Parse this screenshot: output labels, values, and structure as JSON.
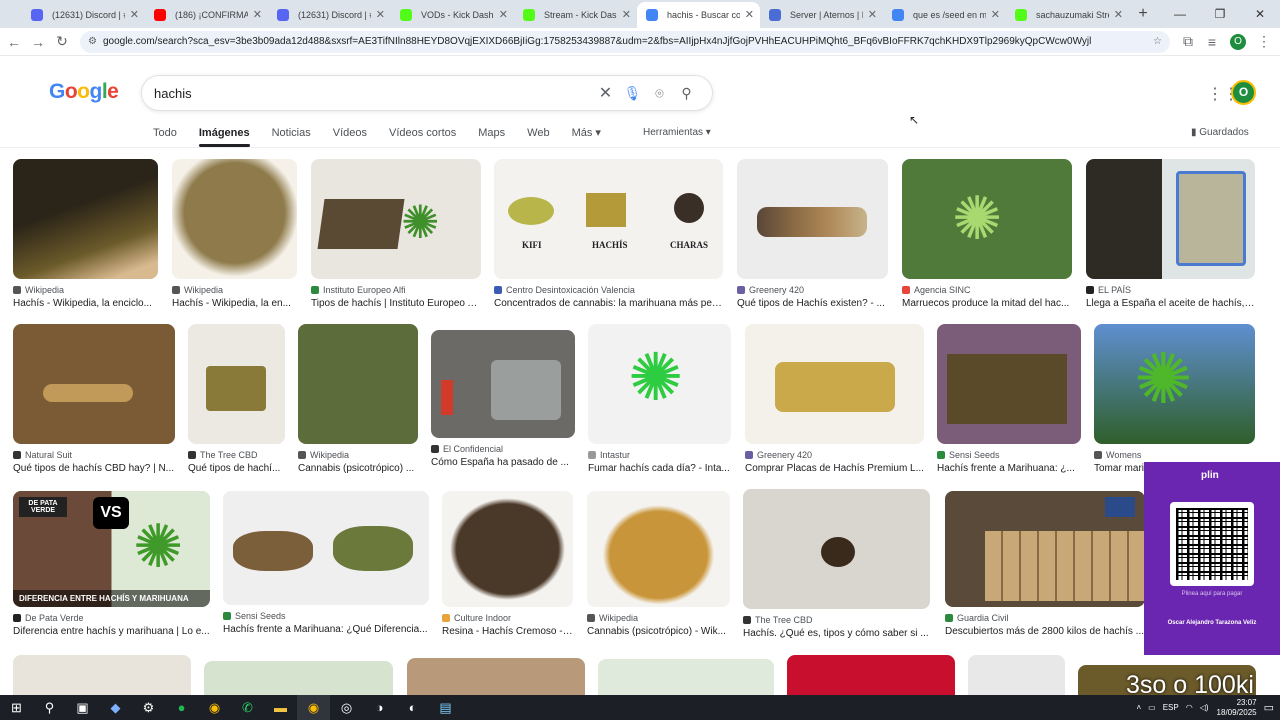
{
  "browser": {
    "tabs": [
      {
        "title": "(12631) Discord | #C",
        "color": "#5865f2"
      },
      {
        "title": "(186) ¡CONFIRMA",
        "color": "#ff0000"
      },
      {
        "title": "(12631) Discord | #",
        "color": "#5865f2"
      },
      {
        "title": "VODs - Kick Dashbo",
        "color": "#53fc18"
      },
      {
        "title": "Stream - Kick Dashb",
        "color": "#53fc18"
      },
      {
        "title": "hachis - Buscar con G",
        "color": "#4285f4",
        "active": true
      },
      {
        "title": "Server | Aternos | Fre",
        "color": "#4a6cd4"
      },
      {
        "title": "que es /seed en min",
        "color": "#4285f4"
      },
      {
        "title": "sachauzumaki Stream",
        "color": "#53fc18"
      }
    ],
    "url": "google.com/search?sca_esv=3be3b09ada12d488&sxsrf=AE3TifNIln88HEYD8OVqjEXIXD66BjIiGg:1758253439887&udm=2&fbs=AIIjpHx4nJjfGojPVHhEACUHPiMQht6_BFq6vBIoFFRK7qchKHDX9Tlp2969kyQpCWcw0Wyjl"
  },
  "search": {
    "logo": "Google",
    "query": "hachis",
    "account_initial": "O",
    "nav": [
      "Todo",
      "Imágenes",
      "Noticias",
      "Vídeos",
      "Vídeos cortos",
      "Maps",
      "Web",
      "Más ▾"
    ],
    "tools": "Herramientas ▾",
    "saved": "Guardados"
  },
  "results": [
    {
      "src": "Wikipedia",
      "cap": "Hachís - Wikipedia, la enciclo...",
      "favcolor": "#555"
    },
    {
      "src": "Wikipedia",
      "cap": "Hachís - Wikipedia, la en...",
      "favcolor": "#555"
    },
    {
      "src": "Instituto Europeo Alfi",
      "cap": "Tipos de hachís | Instituto Europeo Alfi",
      "favcolor": "#2b8a3e"
    },
    {
      "src": "Centro Desintoxicación Valencia",
      "cap": "Concentrados de cannabis: la marihuana más peli...",
      "favcolor": "#3b5bb5"
    },
    {
      "src": "Greenery 420",
      "cap": "Qué tipos de Hachís existen? - ...",
      "favcolor": "#6b5fa3"
    },
    {
      "src": "Agencia SINC",
      "cap": "Marruecos produce la mitad del hac...",
      "favcolor": "#e8453c"
    },
    {
      "src": "EL PAÍS",
      "cap": "Llega a España el aceite de hachís, ...",
      "favcolor": "#222"
    },
    {
      "src": "Natural Suit",
      "cap": "Qué tipos de hachís CBD hay? | N...",
      "favcolor": "#333"
    },
    {
      "src": "The Tree CBD",
      "cap": "Qué tipos de hachí...",
      "favcolor": "#333"
    },
    {
      "src": "Wikipedia",
      "cap": "Cannabis (psicotrópico) ...",
      "favcolor": "#555"
    },
    {
      "src": "El Confidencial",
      "cap": "Cómo España ha pasado de ...",
      "favcolor": "#333"
    },
    {
      "src": "Intastur",
      "cap": "Fumar hachís cada día? - Inta...",
      "favcolor": "#999"
    },
    {
      "src": "Greenery 420",
      "cap": "Comprar Placas de Hachís Premium L...",
      "favcolor": "#6b5fa3"
    },
    {
      "src": "Sensi Seeds",
      "cap": "Hachís frente a Marihuana: ¿...",
      "favcolor": "#2b8a3e"
    },
    {
      "src": "Womens",
      "cap": "Tomar mari...",
      "favcolor": "#555"
    },
    {
      "src": "De Pata Verde",
      "cap": "Diferencia entre hachís y marihuana | Lo e...",
      "favcolor": "#222"
    },
    {
      "src": "Sensi Seeds",
      "cap": "Hachís frente a Marihuana: ¿Qué Diferencia...",
      "favcolor": "#2b8a3e"
    },
    {
      "src": "Culture Indoor",
      "cap": "Resina - Hachís Cremoso - ...",
      "favcolor": "#e8a33c"
    },
    {
      "src": "Wikipedia",
      "cap": "Cannabis (psicotrópico) - Wik...",
      "favcolor": "#555"
    },
    {
      "src": "The Tree CBD",
      "cap": "Hachís. ¿Qué es, tipos y cómo saber si ...",
      "favcolor": "#333"
    },
    {
      "src": "Guardia Civil",
      "cap": "Descubiertos más de 2800 kilos de hachís ...",
      "favcolor": "#2b8a3e"
    }
  ],
  "image_labels": {
    "kifi": "KIFI",
    "hachis": "HACHÍS",
    "charas": "CHARAS",
    "depata": "DE PATA VERDE",
    "vs": "VS",
    "diferencia": "DIFERENCIA ENTRE HACHÍS Y MARIHUANA"
  },
  "overlay": {
    "qr_logo": "plin",
    "qr_sub": "Plinea aquí para pagar",
    "qr_name": "Oscar Alejandro Tarazona Veliz",
    "corner_text": "3so o 100ki"
  },
  "taskbar": {
    "lang": "ESP",
    "time": "23:07",
    "date": "18/09/2025"
  }
}
